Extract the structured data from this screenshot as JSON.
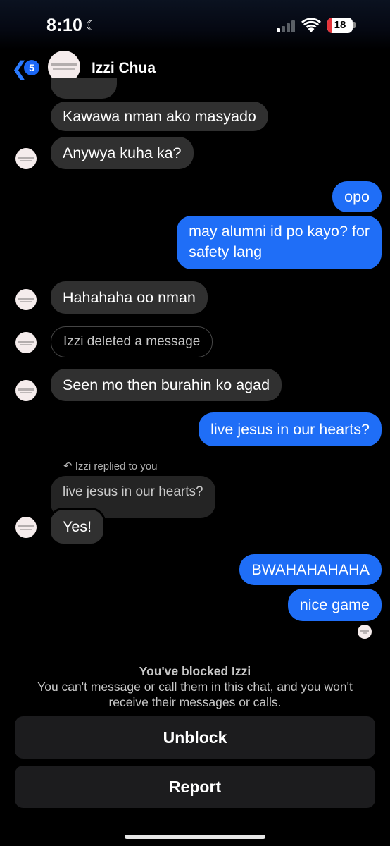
{
  "status_bar": {
    "time": "8:10",
    "battery": 18
  },
  "header": {
    "back_count": "5",
    "contact_name": "Izzi Chua"
  },
  "messages": [
    {
      "dir": "in",
      "text": "Kawawa nman ako masyado"
    },
    {
      "dir": "in",
      "text": "Anywya kuha ka?"
    },
    {
      "dir": "out",
      "text": "opo"
    },
    {
      "dir": "out",
      "lines": [
        "may alumni id po kayo? for",
        "safety lang"
      ]
    },
    {
      "dir": "in",
      "text": "Hahahaha oo nman"
    },
    {
      "dir": "in",
      "text": "Izzi deleted a message",
      "kind": "deleted"
    },
    {
      "dir": "in",
      "text": "Seen mo then burahin ko agad"
    },
    {
      "dir": "out",
      "text": "live jesus in our hearts?"
    },
    {
      "dir": "in",
      "reply_label": "Izzi replied to you",
      "quoted": "live jesus in our hearts?",
      "text": "Yes!"
    },
    {
      "dir": "out",
      "text": "BWAHAHAHAHA"
    },
    {
      "dir": "out",
      "text": "nice game"
    }
  ],
  "blocked": {
    "title": "You've blocked Izzi",
    "text": "You can't message or call them in this chat, and you won't receive their messages or calls.",
    "unblock_label": "Unblock",
    "report_label": "Report"
  }
}
